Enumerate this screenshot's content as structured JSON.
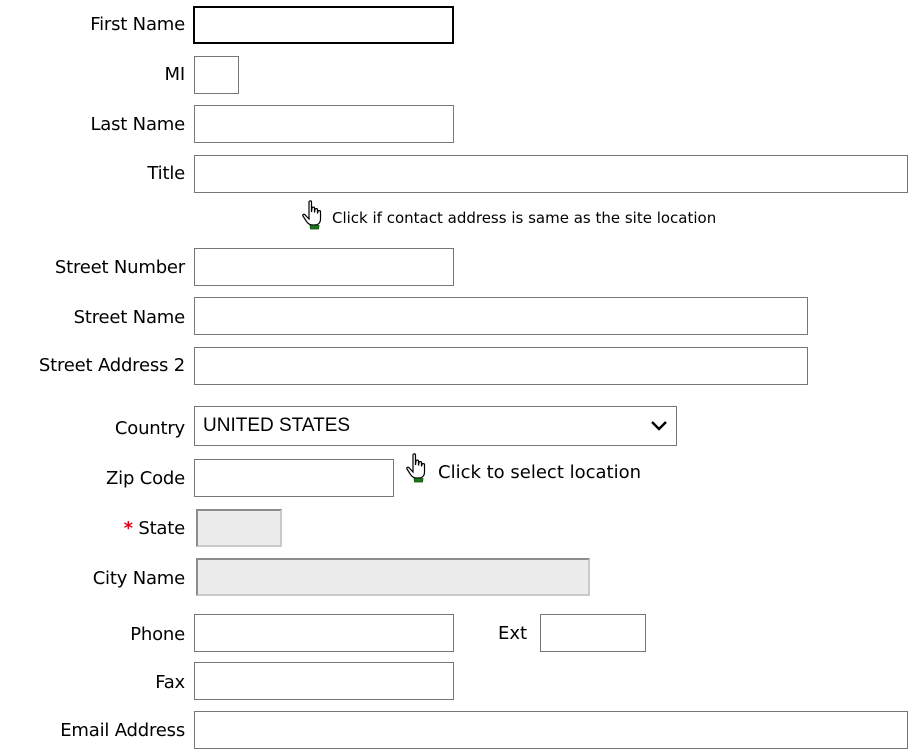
{
  "form": {
    "first_name": {
      "label": "First Name",
      "value": ""
    },
    "mi": {
      "label": "MI",
      "value": ""
    },
    "last_name": {
      "label": "Last Name",
      "value": ""
    },
    "title": {
      "label": "Title",
      "value": ""
    },
    "same_address_hint": {
      "icon": "hand-pointer-icon",
      "text": "Click if contact address is same as the site location"
    },
    "street_number": {
      "label": "Street Number",
      "value": ""
    },
    "street_name": {
      "label": "Street Name",
      "value": ""
    },
    "street_address_2": {
      "label": "Street Address 2",
      "value": ""
    },
    "country": {
      "label": "Country",
      "selected": "UNITED STATES",
      "icon": "chevron-down-icon"
    },
    "zip_code": {
      "label": "Zip Code",
      "value": ""
    },
    "select_location_hint": {
      "icon": "hand-pointer-icon",
      "text": "Click to select location"
    },
    "state": {
      "required_marker": "*",
      "label": "State",
      "value": ""
    },
    "city_name": {
      "label": "City Name",
      "value": ""
    },
    "phone": {
      "label": "Phone",
      "value": ""
    },
    "ext": {
      "label": "Ext",
      "value": ""
    },
    "fax": {
      "label": "Fax",
      "value": ""
    },
    "email_address": {
      "label": "Email Address",
      "value": ""
    }
  },
  "colors": {
    "required": "#e0001b",
    "disabled_bg": "#ececec",
    "border": "#767676",
    "icon_green": "#1a7a1a"
  }
}
